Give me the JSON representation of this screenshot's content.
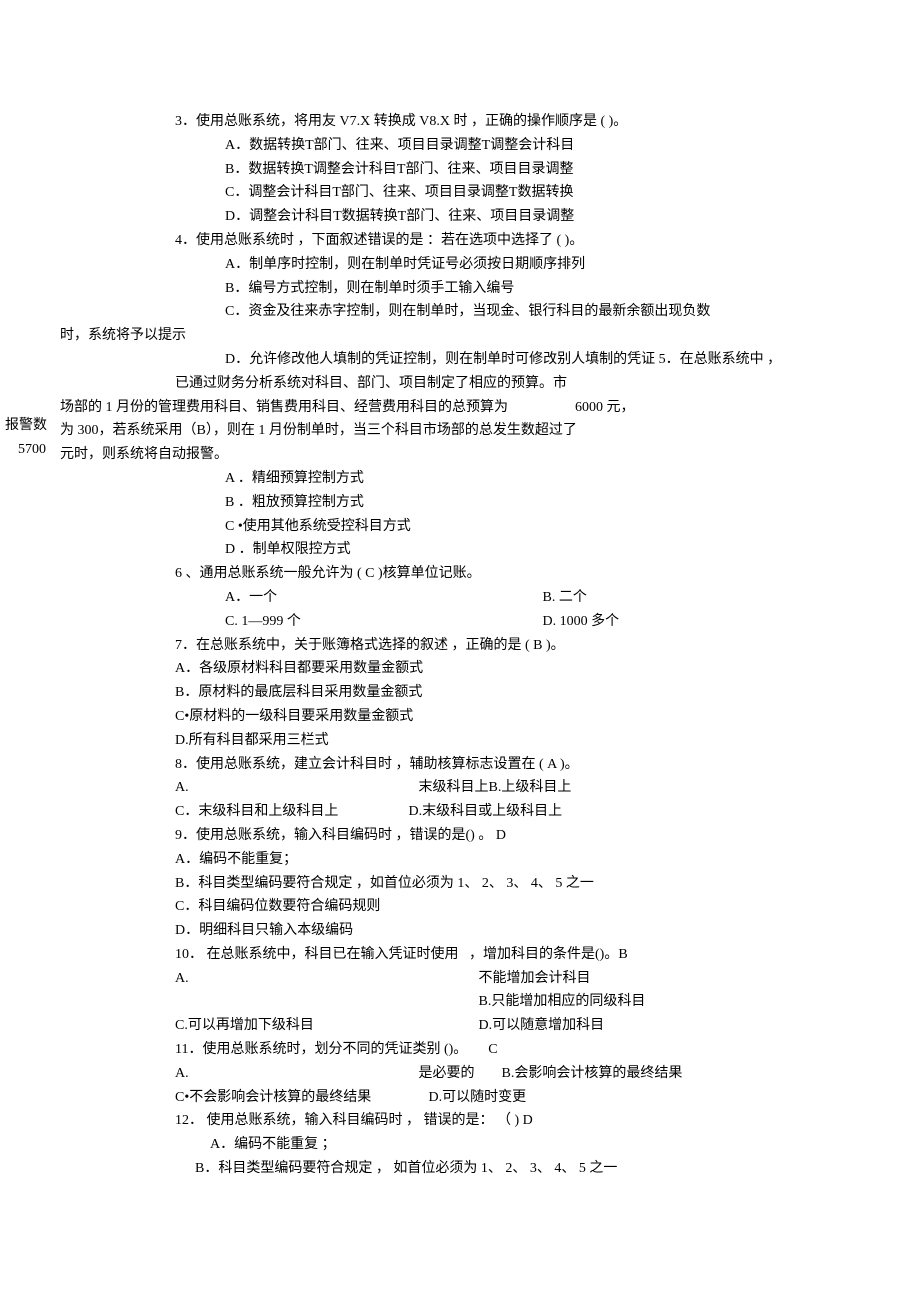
{
  "margin": {
    "note1": "报警数",
    "note2": "5700"
  },
  "q3": {
    "stem": "3．使用总账系统，将用友 V7.X 转换成 V8.X 时 ，正确的操作顺序是 ( )。",
    "a": "A．数据转换T部门、往来、项目目录调整T调整会计科目",
    "b": "B．数据转换T调整会计科目T部门、往来、项目目录调整",
    "c": "C．调整会计科目T部门、往来、项目目录调整T数据转换",
    "d": "D．调整会计科目T数据转换T部门、往来、项目目录调整"
  },
  "q4": {
    "stem": "4．使用总账系统时 ，下面叙述错误的是 ：若在选项中选择了 ( )。",
    "a": "A．制单序时控制，则在制单时凭证号必须按日期顺序排列",
    "b": "B．编号方式控制，则在制单时须手工输入编号",
    "c": "C．资金及往来赤字控制，则在制单时，当现金、银行科目的最新余额出现负数",
    "c_tail": "时，系统将予以提示",
    "d": "D．允许修改他人填制的凭证控制，则在制单时可修改别人填制的凭证 5．在总账系统中 ，"
  },
  "q5": {
    "line1": "已通过财务分析系统对科目、部门、项目制定了相应的预算。市",
    "line2a": "场部的 1 月份的管理费用科目、销售费用科目、经营费用科目的总预算为",
    "line2b": "6000 元，",
    "line3": "为 300，若系统采用（B），则在 1 月份制单时，当三个科目市场部的总发生数超过了",
    "line4": "元时，则系统将自动报警。",
    "a": "A ．精细预算控制方式",
    "b": "B ．粗放预算控制方式",
    "c": "C •使用其他系统受控科目方式",
    "d": "D ．制单权限控方式"
  },
  "q6": {
    "stem": "6 、通用总账系统一般允许为 ( C )核算单位记账。",
    "a": "A．一个",
    "b": "B. 二个",
    "c": "C. 1—999 个",
    "d": "D. 1000 多个"
  },
  "q7": {
    "stem": "7．在总账系统中，关于账簿格式选择的叙述 ，正确的是 ( B )。",
    "a": "A．各级原材料科目都要采用数量金额式",
    "b": "B．原材料的最底层科目采用数量金额式",
    "c": "C•原材料的一级科目要采用数量金额式",
    "d": "D.所有科目都采用三栏式"
  },
  "q8": {
    "stem": "8．使用总账系统，建立会计科目时 ，辅助核算标志设置在 ( A )。",
    "a": "A.",
    "a2": "末级科目上",
    "b": "B.上级科目上",
    "c": "C．末级科目和上级科目上",
    "d": "D.末级科目或上级科目上"
  },
  "q9": {
    "stem": "9．使用总账系统，输入科目编码时 ，错误的是() 。 D",
    "a": "A．编码不能重复；",
    "b": "B．科目类型编码要符合规定 ，如首位必须为 1、 2、 3、 4、 5 之一",
    "c": "C．科目编码位数要符合编码规则",
    "d": "D．明细科目只输入本级编码"
  },
  "q10": {
    "stem": "10． 在总账系统中，科目已在输入凭证时使用   ，增加科目的条件是()。B",
    "a": "A.",
    "a2": "不能增加会计科目",
    "b": "B.只能增加相应的同级科目",
    "c": "C.可以再增加下级科目",
    "d": "D.可以随意增加科目"
  },
  "q11": {
    "stem": "11．使用总账系统时，划分不同的凭证类别 ()。      C",
    "a": "A.",
    "a2": "是必要的",
    "b": "B.会影响会计核算的最终结果",
    "c": "C•不会影响会计核算的最终结果",
    "d": "D.可以随时变更"
  },
  "q12": {
    "stem": "12． 使用总账系统，输入科目编码时 ， 错误的是： （ ) D",
    "a": "A．编码不能重复 ；",
    "b": "B．科目类型编码要符合规定 ， 如首位必须为 1、 2、 3、 4、 5 之一"
  }
}
